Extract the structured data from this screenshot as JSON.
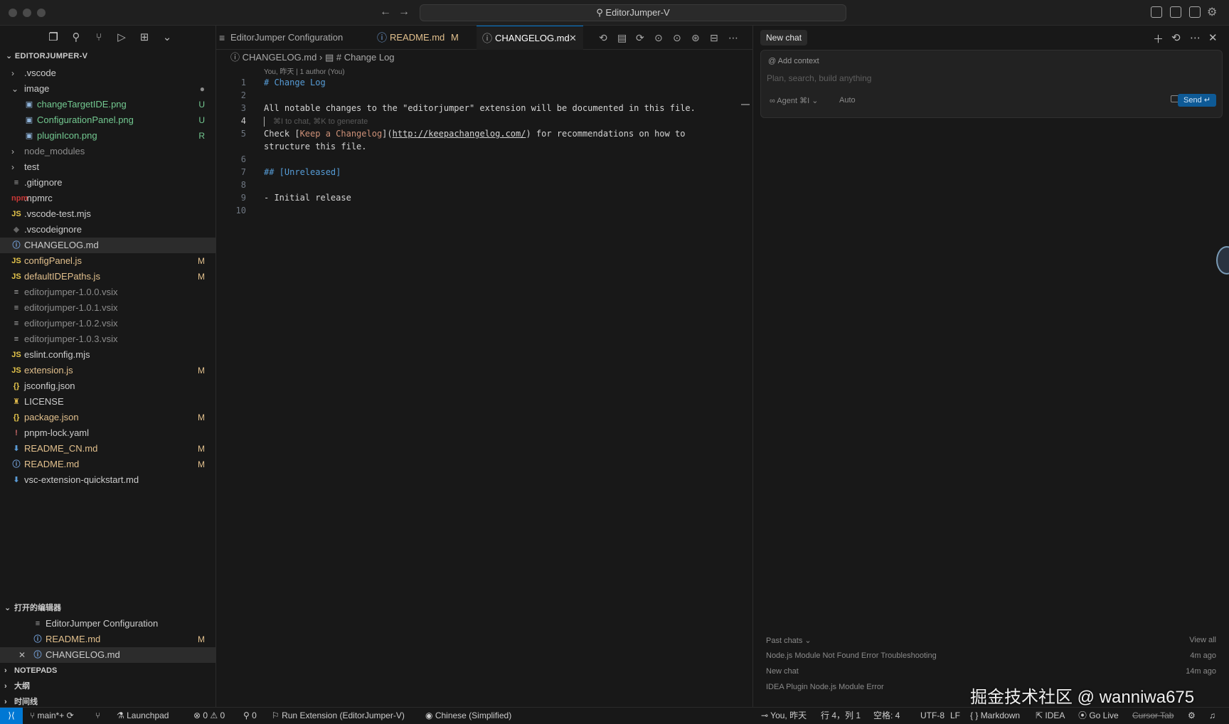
{
  "window": {
    "search_title": "EditorJumper-V"
  },
  "sidebar": {
    "title": "EDITORJUMPER-V",
    "tree": [
      {
        "label": ".vscode",
        "kind": "folder",
        "depth": 0,
        "expanded": false,
        "color": "txt",
        "badge": ""
      },
      {
        "label": "image",
        "kind": "folder",
        "depth": 0,
        "expanded": true,
        "color": "txt",
        "badge": "●"
      },
      {
        "label": "changeTargetIDE.png",
        "kind": "image",
        "depth": 1,
        "color": "new",
        "badge": "U"
      },
      {
        "label": "ConfigurationPanel.png",
        "kind": "image",
        "depth": 1,
        "color": "new",
        "badge": "U"
      },
      {
        "label": "pluginIcon.png",
        "kind": "image",
        "depth": 1,
        "color": "new",
        "badge": "R"
      },
      {
        "label": "node_modules",
        "kind": "folder",
        "depth": 0,
        "expanded": false,
        "color": "dim",
        "badge": ""
      },
      {
        "label": "test",
        "kind": "folder",
        "depth": 0,
        "expanded": false,
        "color": "txt",
        "badge": ""
      },
      {
        "label": ".gitignore",
        "kind": "text",
        "depth": 0,
        "color": "txt",
        "badge": ""
      },
      {
        "label": ".npmrc",
        "kind": "npm",
        "depth": 0,
        "color": "txt",
        "badge": ""
      },
      {
        "label": ".vscode-test.mjs",
        "kind": "js",
        "depth": 0,
        "color": "txt",
        "badge": ""
      },
      {
        "label": ".vscodeignore",
        "kind": "ignore",
        "depth": 0,
        "color": "txt",
        "badge": ""
      },
      {
        "label": "CHANGELOG.md",
        "kind": "info",
        "depth": 0,
        "color": "txt",
        "badge": "",
        "selected": true
      },
      {
        "label": "configPanel.js",
        "kind": "js",
        "depth": 0,
        "color": "mod",
        "badge": "M"
      },
      {
        "label": "defaultIDEPaths.js",
        "kind": "js",
        "depth": 0,
        "color": "mod",
        "badge": "M"
      },
      {
        "label": "editorjumper-1.0.0.vsix",
        "kind": "text",
        "depth": 0,
        "color": "dim",
        "badge": ""
      },
      {
        "label": "editorjumper-1.0.1.vsix",
        "kind": "text",
        "depth": 0,
        "color": "dim",
        "badge": ""
      },
      {
        "label": "editorjumper-1.0.2.vsix",
        "kind": "text",
        "depth": 0,
        "color": "dim",
        "badge": ""
      },
      {
        "label": "editorjumper-1.0.3.vsix",
        "kind": "text",
        "depth": 0,
        "color": "dim",
        "badge": ""
      },
      {
        "label": "eslint.config.mjs",
        "kind": "js",
        "depth": 0,
        "color": "txt",
        "badge": ""
      },
      {
        "label": "extension.js",
        "kind": "js",
        "depth": 0,
        "color": "mod",
        "badge": "M"
      },
      {
        "label": "jsconfig.json",
        "kind": "json",
        "depth": 0,
        "color": "txt",
        "badge": ""
      },
      {
        "label": "LICENSE",
        "kind": "license",
        "depth": 0,
        "color": "txt",
        "badge": ""
      },
      {
        "label": "package.json",
        "kind": "json",
        "depth": 0,
        "color": "mod",
        "badge": "M"
      },
      {
        "label": "pnpm-lock.yaml",
        "kind": "yaml",
        "depth": 0,
        "color": "txt",
        "badge": ""
      },
      {
        "label": "README_CN.md",
        "kind": "md",
        "depth": 0,
        "color": "mod",
        "badge": "M"
      },
      {
        "label": "README.md",
        "kind": "info",
        "depth": 0,
        "color": "mod",
        "badge": "M"
      },
      {
        "label": "vsc-extension-quickstart.md",
        "kind": "md",
        "depth": 0,
        "color": "txt",
        "badge": ""
      }
    ],
    "open_editors": {
      "title": "打开的编辑器",
      "items": [
        {
          "label": "EditorJumper Configuration",
          "kind": "text",
          "color": "txt",
          "badge": ""
        },
        {
          "label": "README.md",
          "kind": "info",
          "color": "mod",
          "badge": "M"
        },
        {
          "label": "CHANGELOG.md",
          "kind": "info",
          "color": "txt",
          "badge": "",
          "active": true
        }
      ]
    },
    "notepads": "NOTEPADS",
    "outline": "大纲",
    "timeline": "时间线"
  },
  "editor": {
    "tabs": [
      {
        "label": "EditorJumper Configuration",
        "badge": ""
      },
      {
        "label": "README.md",
        "badge": "M"
      },
      {
        "label": "CHANGELOG.md",
        "badge": ""
      }
    ],
    "breadcrumb": {
      "file": "CHANGELOG.md",
      "section": "# Change Log"
    },
    "blame": "You, 昨天 | 1 author (You)",
    "lines": [
      {
        "n": "1",
        "parts": [
          {
            "t": "# Change Log",
            "c": "h"
          }
        ]
      },
      {
        "n": "2",
        "parts": []
      },
      {
        "n": "3",
        "parts": [
          {
            "t": "All notable changes to the \"editorjumper\" extension will be documented in this file.",
            "c": ""
          }
        ]
      },
      {
        "n": "4",
        "parts": [
          {
            "t": "⌘I to chat, ⌘K to generate",
            "c": "ghost"
          }
        ],
        "current": true
      },
      {
        "n": "5",
        "parts": [
          {
            "t": "Check [",
            "c": ""
          },
          {
            "t": "Keep a Changelog",
            "c": "link"
          },
          {
            "t": "](",
            "c": ""
          },
          {
            "t": "http://keepachangelog.com/",
            "c": "url"
          },
          {
            "t": ") for recommendations on how to",
            "c": ""
          }
        ]
      },
      {
        "n": "",
        "parts": [
          {
            "t": "structure this file.",
            "c": ""
          }
        ]
      },
      {
        "n": "6",
        "parts": []
      },
      {
        "n": "7",
        "parts": [
          {
            "t": "## [Unreleased]",
            "c": "h"
          }
        ]
      },
      {
        "n": "8",
        "parts": []
      },
      {
        "n": "9",
        "parts": [
          {
            "t": "- Initial release",
            "c": ""
          }
        ]
      },
      {
        "n": "10",
        "parts": []
      }
    ]
  },
  "chat": {
    "tab_label": "New chat",
    "add_context": "Add context",
    "placeholder": "Plan, search, build anything",
    "agent_label": "∞ Agent ⌘I ⌄",
    "model_label": "Auto",
    "send_label": "Send ↵",
    "past_chats_label": "Past chats ⌄",
    "view_all": "View all",
    "past": [
      {
        "title": "Node.js Module Not Found Error Troubleshooting",
        "time": "4m ago"
      },
      {
        "title": "New chat",
        "time": "14m ago"
      },
      {
        "title": "IDEA Plugin Node.js Module Error",
        "time": ""
      }
    ]
  },
  "watermark": "掘金技术社区 @ wanniwa675",
  "statusbar": {
    "remote": "⟩⟨",
    "branch": "main*+",
    "launchpad": "Launchpad",
    "problems": "⊗ 0 ⚠ 0",
    "ports": "⚲ 0",
    "run": "Run Extension (EditorJumper-V)",
    "language_pack": "Chinese (Simplified)",
    "blame": "You, 昨天",
    "position": "行 4，列 1",
    "spaces": "空格: 4",
    "encoding": "UTF-8",
    "eol": "LF",
    "language": "Markdown",
    "idea": "IDEA",
    "golive": "Go Live",
    "cursor_tab": "Cursor Tab"
  }
}
